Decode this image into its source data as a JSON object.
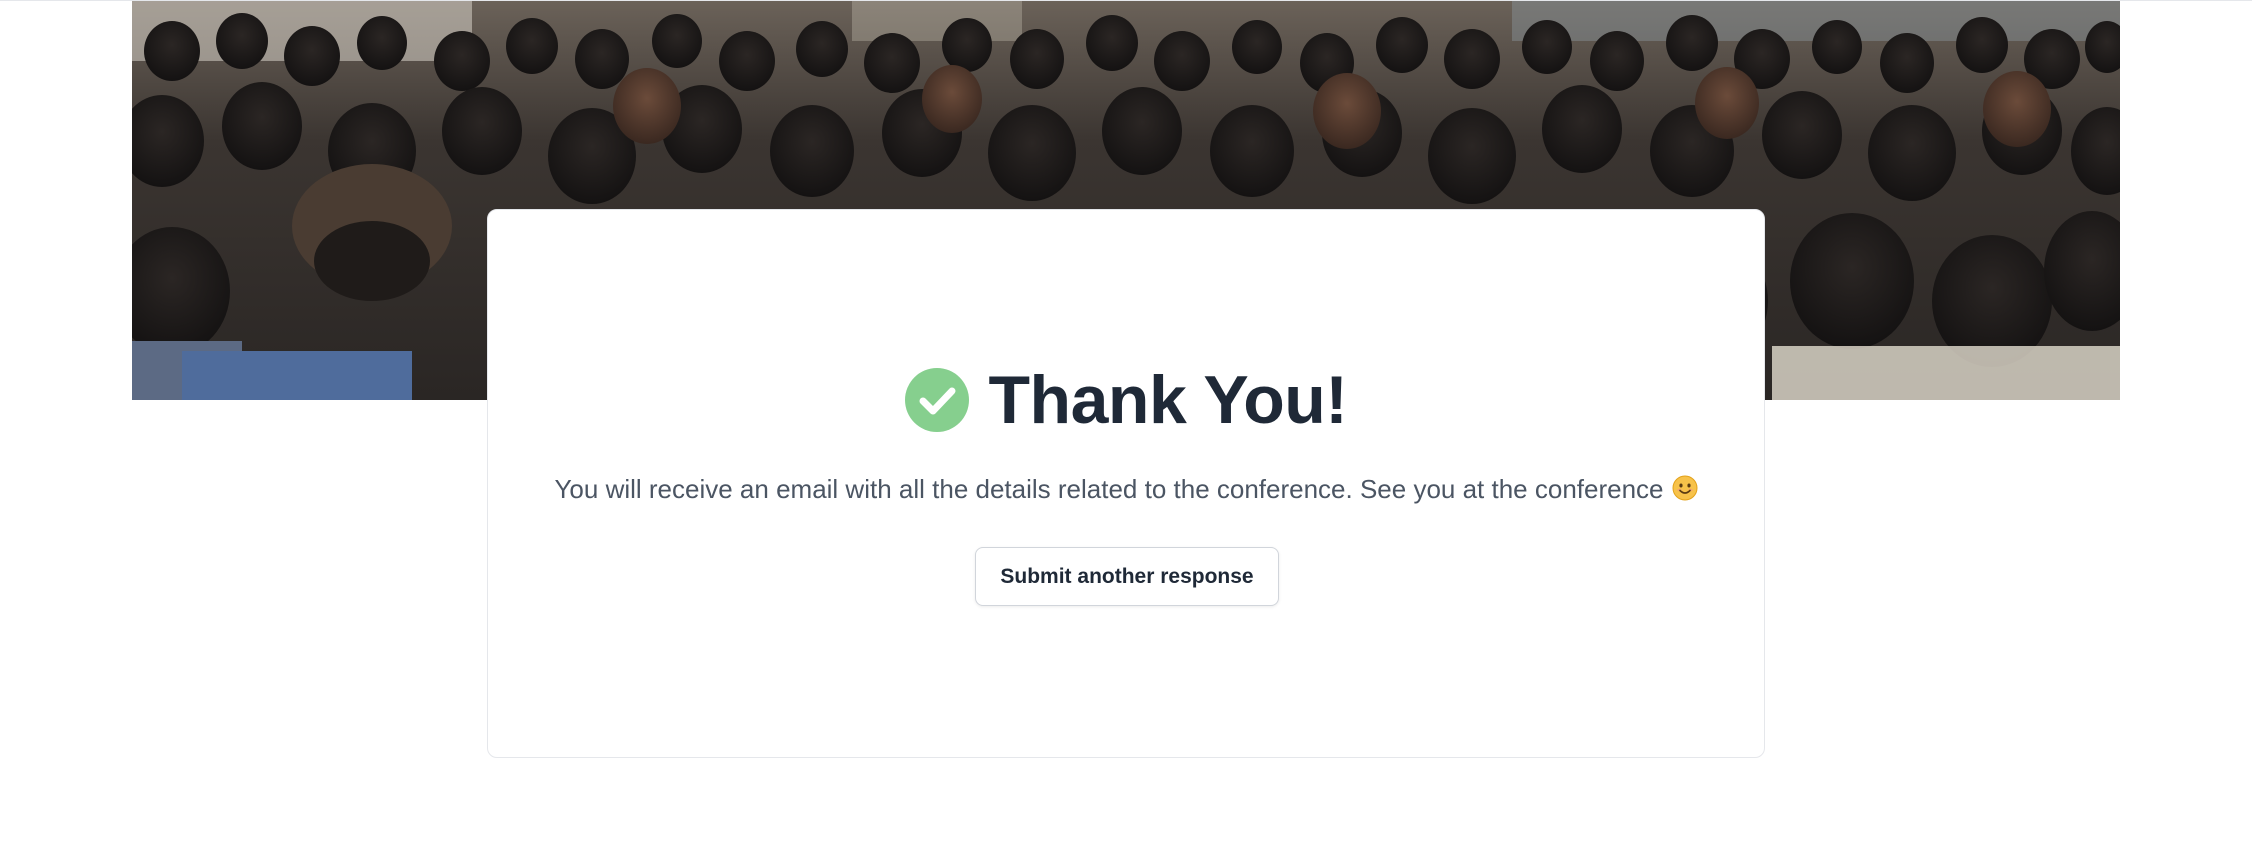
{
  "cover_image": {
    "alt": "conference audience"
  },
  "confirmation": {
    "title": "Thank You!",
    "message": "You will receive an email with all the details related to the conference. See you at the conference",
    "emoji_icon": "smiling-face-icon",
    "status_icon": "check-circle-icon",
    "accent_color": "#86cf8e"
  },
  "actions": {
    "submit_another_label": "Submit another response"
  }
}
